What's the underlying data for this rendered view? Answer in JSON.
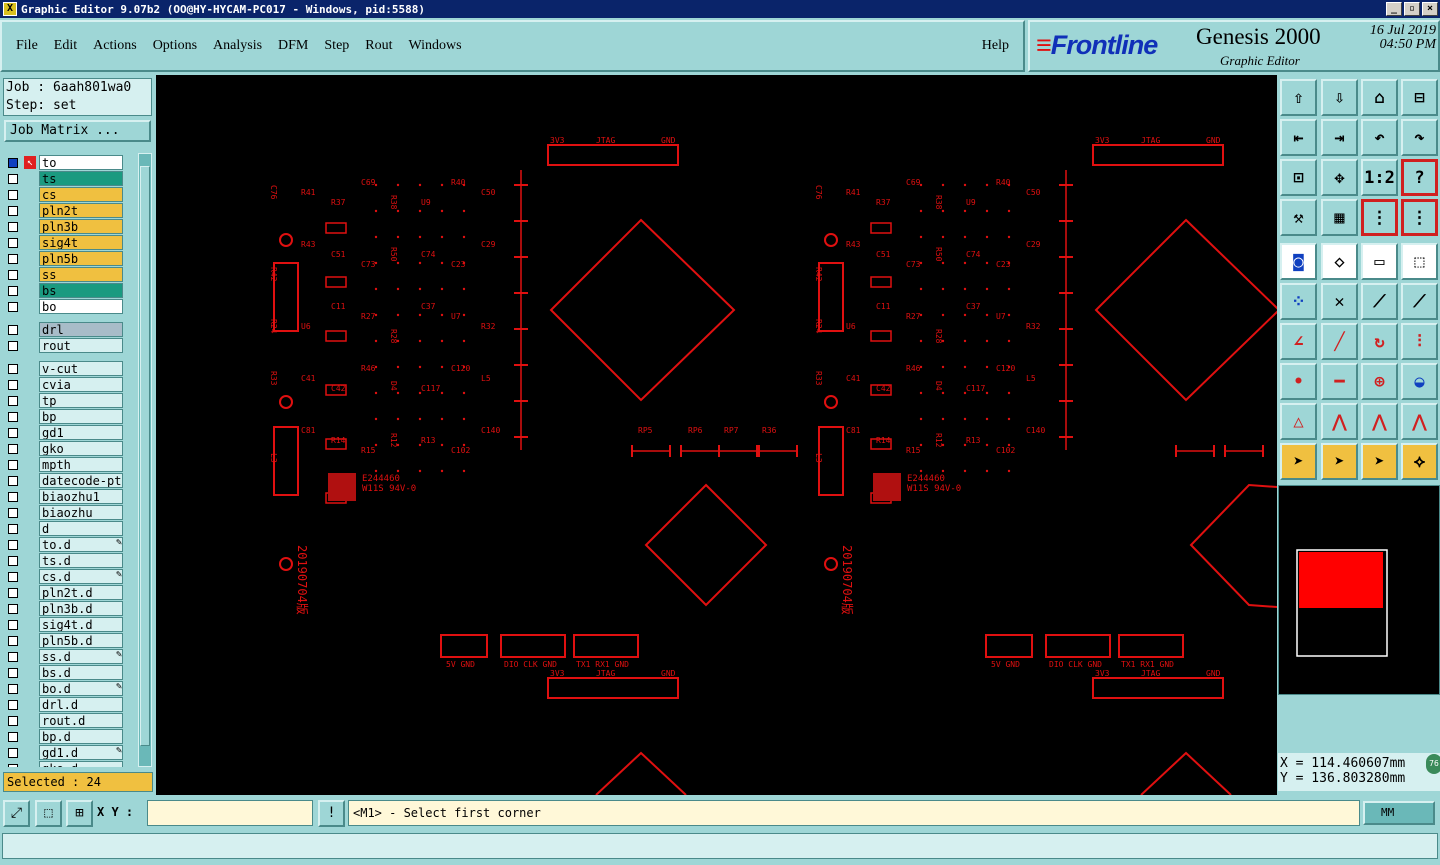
{
  "window": {
    "title": "Graphic Editor 9.07b2 (OO@HY-HYCAM-PC017 - Windows, pid:5588)",
    "app_icon": "X",
    "controls": [
      "_",
      "▫",
      "×"
    ]
  },
  "menu": {
    "items": [
      {
        "label": "File"
      },
      {
        "label": "Edit"
      },
      {
        "label": "Actions"
      },
      {
        "label": "Options"
      },
      {
        "label": "Analysis"
      },
      {
        "label": "DFM"
      },
      {
        "label": "Step"
      },
      {
        "label": "Rout"
      },
      {
        "label": "Windows"
      }
    ],
    "help": "Help"
  },
  "brand": {
    "logo": "Frontline",
    "product": "Genesis 2000",
    "subtitle": "Graphic Editor",
    "date": "16 Jul 2019",
    "time": "04:50 PM"
  },
  "job": {
    "job_line": "Job : 6aah801wa0",
    "step_line": "Step: set",
    "matrix_button": "Job Matrix ..."
  },
  "layers_board": [
    {
      "name": "to",
      "color": "#ffffff"
    },
    {
      "name": "ts",
      "color": "#1a9a80"
    },
    {
      "name": "cs",
      "color": "#f0c040"
    },
    {
      "name": "pln2t",
      "color": "#f0c040"
    },
    {
      "name": "pln3b",
      "color": "#f0c040"
    },
    {
      "name": "sig4t",
      "color": "#f0c040"
    },
    {
      "name": "pln5b",
      "color": "#f0c040"
    },
    {
      "name": "ss",
      "color": "#f0c040"
    },
    {
      "name": "bs",
      "color": "#1a9a80"
    },
    {
      "name": "bo",
      "color": "#ffffff"
    }
  ],
  "layers_drill": [
    {
      "name": "drl",
      "color": "#a8bcc8"
    },
    {
      "name": "rout",
      "color": "#d6f0f0"
    }
  ],
  "layers_misc": [
    {
      "name": "v-cut",
      "edit": ""
    },
    {
      "name": "cvia",
      "edit": ""
    },
    {
      "name": "tp",
      "edit": ""
    },
    {
      "name": "bp",
      "edit": ""
    },
    {
      "name": "gd1",
      "edit": ""
    },
    {
      "name": "gko",
      "edit": ""
    },
    {
      "name": "mpth",
      "edit": ""
    },
    {
      "name": "datecode-pt",
      "edit": ""
    },
    {
      "name": "biaozhu1",
      "edit": ""
    },
    {
      "name": "biaozhu",
      "edit": ""
    },
    {
      "name": "d",
      "edit": ""
    },
    {
      "name": "to.d",
      "edit": "✎"
    },
    {
      "name": "ts.d",
      "edit": ""
    },
    {
      "name": "cs.d",
      "edit": "✎"
    },
    {
      "name": "pln2t.d",
      "edit": ""
    },
    {
      "name": "pln3b.d",
      "edit": ""
    },
    {
      "name": "sig4t.d",
      "edit": ""
    },
    {
      "name": "pln5b.d",
      "edit": ""
    },
    {
      "name": "ss.d",
      "edit": "✎"
    },
    {
      "name": "bs.d",
      "edit": ""
    },
    {
      "name": "bo.d",
      "edit": "✎"
    },
    {
      "name": "drl.d",
      "edit": ""
    },
    {
      "name": "rout.d",
      "edit": ""
    },
    {
      "name": "bp.d",
      "edit": ""
    },
    {
      "name": "gd1.d",
      "edit": "✎"
    },
    {
      "name": "gko.d",
      "edit": ""
    }
  ],
  "status": {
    "selected": "Selected : 24",
    "xy_label": "X Y :",
    "xy_value": "",
    "prompt": "<M1> - Select first corner",
    "units": "MM",
    "x_coord": "X = 114.460607mm",
    "y_coord": "Y = 136.803280mm",
    "badge": "76"
  },
  "canvas_text": {
    "date_code": "20190704版",
    "ul_mark": "E244460",
    "ul_sub": "W11S 94V-0",
    "conn_labels": [
      "3V3",
      "JTAG",
      "GND"
    ],
    "conn_bottom_a": "5V  GND",
    "conn_bottom_b": "DIO CLK GND",
    "conn_bottom_c": "TX1 RX1 GND",
    "refs": [
      "C76",
      "R41",
      "R37",
      "C69",
      "R38",
      "U9",
      "R40",
      "C50",
      "R42",
      "R43",
      "C51",
      "C73",
      "R50",
      "C74",
      "C23",
      "C29",
      "R24",
      "U6",
      "C11",
      "R27",
      "R28",
      "C37",
      "U7",
      "R32",
      "R33",
      "C41",
      "C42",
      "R46",
      "D4",
      "C117",
      "C120",
      "L5",
      "L3",
      "C81",
      "R14",
      "R15",
      "R12",
      "R13",
      "C102",
      "C140",
      "R7",
      "P5",
      "P4",
      "C48",
      "R104",
      "D3",
      "U4",
      "U1",
      "Y1",
      "Y2",
      "RP14",
      "RP16",
      "RP13",
      "RP10",
      "RP1",
      "RP2",
      "RP3",
      "RP4",
      "RP5",
      "RP6",
      "RP7",
      "R36",
      "R26",
      "R49",
      "D1",
      "D2",
      "R1",
      "R4",
      "R51",
      "P1",
      "C92",
      "C94",
      "C89",
      "C58",
      "U8",
      "C71",
      "R11",
      "R16",
      "L1",
      "L2",
      "C22",
      "C33",
      "C54",
      "C59",
      "R34"
    ]
  },
  "icons": {
    "toolbar": [
      "job-open-icon",
      "save-icon",
      "home-icon",
      "window-icon",
      "step-back-icon",
      "step-forward-icon",
      "undo-icon",
      "redo-icon",
      "zoom-fit-icon",
      "zoom-center-icon",
      "zoom-ratio-icon",
      "help-icon",
      "measure-icon",
      "grid-icon",
      "snap-icon",
      "snap-all-icon",
      "pad-icon",
      "polygon-icon",
      "ruler-icon",
      "select-area-icon",
      "connect-icon",
      "cross-icon",
      "line-icon",
      "line-point-icon",
      "angle-icon",
      "diagonal-icon",
      "arc-icon",
      "split-icon",
      "point-icon",
      "segment-icon",
      "dimension-icon",
      "shape-icon",
      "triangle-icon",
      "arch-icon",
      "arch-line-icon",
      "arch-fill-icon",
      "pointer-icon",
      "pointer-box-icon",
      "pointer-select-icon",
      "net-icon"
    ]
  }
}
